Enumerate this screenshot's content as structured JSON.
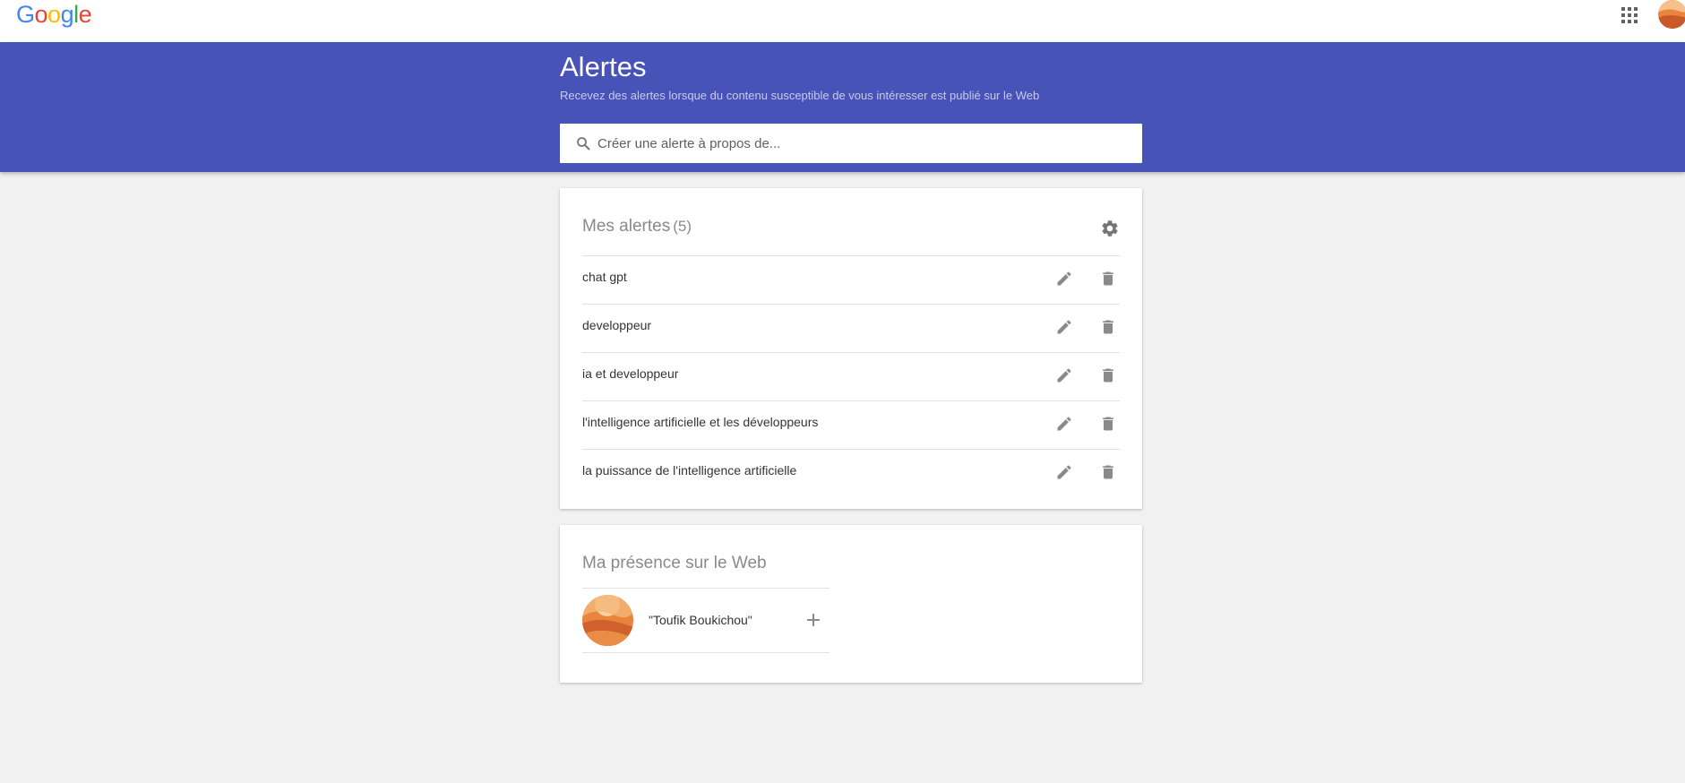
{
  "header": {
    "logo": [
      "G",
      "o",
      "o",
      "g",
      "l",
      "e"
    ],
    "apps_icon": "apps-grid-icon",
    "avatar_icon": "account-avatar-icon"
  },
  "hero": {
    "title": "Alertes",
    "subtitle": "Recevez des alertes lorsque du contenu susceptible de vous intéresser est publié sur le Web",
    "background_color": "#4753b7",
    "search": {
      "placeholder": "Créer une alerte à propos de...",
      "value": "",
      "icon": "search-icon"
    }
  },
  "alerts_card": {
    "title": "Mes alertes",
    "count": "(5)",
    "settings_icon": "gear-icon",
    "items": [
      {
        "label": "chat gpt"
      },
      {
        "label": "developpeur"
      },
      {
        "label": "ia et developpeur"
      },
      {
        "label": "l'intelligence artificielle et les développeurs"
      },
      {
        "label": "la puissance de l'intelligence artificielle"
      }
    ],
    "item_actions": [
      "edit-icon",
      "delete-icon"
    ]
  },
  "presence_card": {
    "title": "Ma présence sur le Web",
    "entry": {
      "name": "\"Toufik Boukichou\"",
      "action_icon": "add-icon"
    }
  }
}
